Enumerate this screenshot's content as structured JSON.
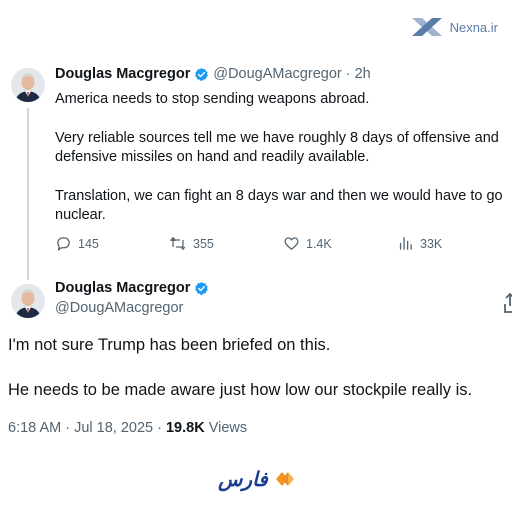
{
  "watermark": {
    "text": "Nexna.ir",
    "color": "#5a7ca8"
  },
  "tweet1": {
    "author_name": "Douglas Macgregor",
    "handle_time": "@DougAMacgregor · 2h",
    "lines": [
      "America needs to stop sending weapons abroad.",
      "Very reliable sources tell me we have roughly 8 days of offensive and",
      "defensive missiles on hand and readily available.",
      "Translation, we can fight an 8 days war and then we would have to go",
      "nuclear."
    ],
    "actions": {
      "replies": "145",
      "reposts": "355",
      "likes": "1.4K",
      "views": "33K"
    }
  },
  "tweet2": {
    "author_name": "Douglas Macgregor",
    "handle": "@DougAMacgregor",
    "text_line1": "I'm not sure Trump has been briefed on this.",
    "text_line2": "He needs to be made aware just how low our stockpile really is.",
    "timestamp": "6:18 AM · Jul 18, 2025 · ",
    "views_count": "19.8K",
    "views_label": " Views"
  },
  "footer_logo": {
    "text": "فارس"
  },
  "colors": {
    "text": "#0f1419",
    "muted": "#536471",
    "verified": "#1d9bf0",
    "thread_line": "#cfd9de",
    "logo_blue": "#1a3f8f",
    "logo_orange": "#f7931e"
  },
  "icons": [
    "nexna-logo-icon",
    "verified-badge-icon",
    "reply-icon",
    "repost-icon",
    "like-icon",
    "views-icon",
    "share-icon",
    "fars-diamond-icon"
  ]
}
